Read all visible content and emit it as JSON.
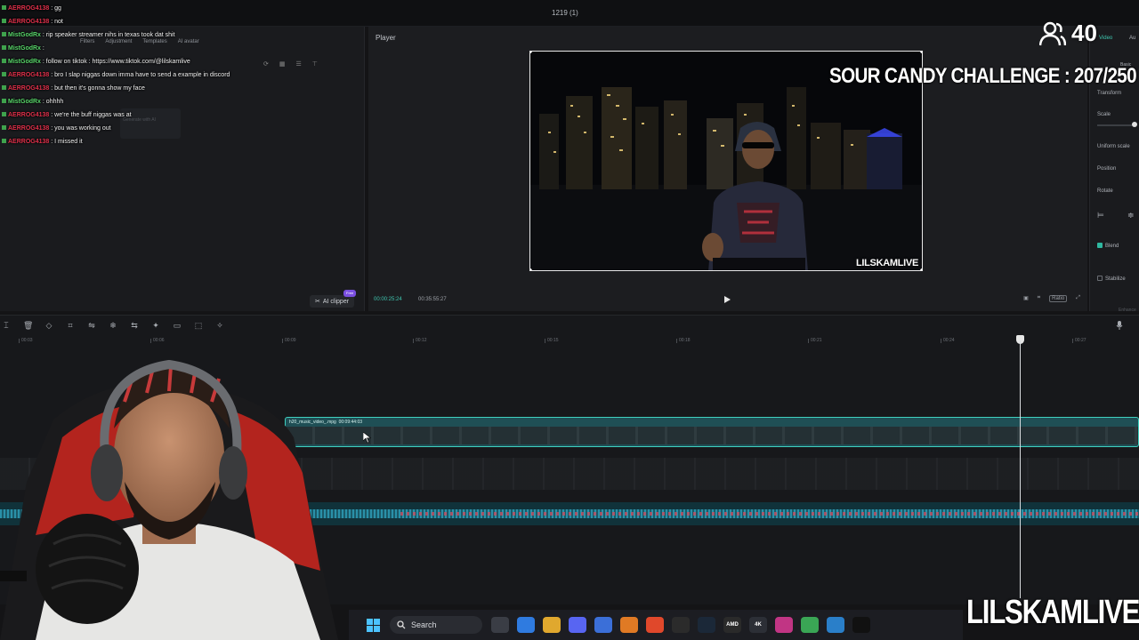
{
  "window": {
    "title": "1219 (1)"
  },
  "media_panel": {
    "tabs": [
      "Filters",
      "Adjustment",
      "Templates",
      "AI avatar"
    ],
    "ghost_label": "Generate with AI",
    "ai_clipper_label": "AI clipper",
    "ai_clipper_badge": "Free"
  },
  "chat": {
    "lines": [
      {
        "user": "AERROG4138",
        "sep": " : ",
        "msg": "gg"
      },
      {
        "user": "AERROG4138",
        "sep": " : ",
        "msg": "not"
      },
      {
        "user": "MistGodRx",
        "sep": " : ",
        "msg": "rip speaker streamer nihs in texas took dat shit"
      },
      {
        "user": "MistGodRx",
        "sep": " : ",
        "msg": ""
      },
      {
        "user": "MistGodRx",
        "sep": " : ",
        "msg": "follow on tiktok : https://www.tiktok.com/@lilskamlive"
      },
      {
        "user": "AERROG4138",
        "sep": " : ",
        "msg": "bro I slap niggas down imma have to send a example in discord"
      },
      {
        "user": "AERROG4138",
        "sep": " : ",
        "msg": "but then it's gonna show my face"
      },
      {
        "user": "MistGodRx",
        "sep": " : ",
        "msg": "ohhhh"
      },
      {
        "user": "AERROG4138",
        "sep": " : ",
        "msg": "we're the buff niggas was at"
      },
      {
        "user": "AERROG4138",
        "sep": " : ",
        "msg": "you was working out"
      },
      {
        "user": "AERROG4138",
        "sep": " : ",
        "msg": "I missed it"
      }
    ]
  },
  "player": {
    "label": "Player",
    "watermark": "LILSKAMLIVE",
    "time_current": "00:00:25:24",
    "time_total": "00:35:55:27",
    "ratio_label": "Ratio"
  },
  "inspector": {
    "tab_video": "Video",
    "tab_audio": "Au",
    "basic": "Basic",
    "transform": "Transform",
    "scale": "Scale",
    "uniform_scale": "Uniform scale",
    "position": "Position",
    "rotate": "Rotate",
    "blend": "Blend",
    "stabilize": "Stabilize",
    "enhance": "Enhance"
  },
  "overlays": {
    "viewer_count": "40",
    "challenge": "SOUR CANDY CHALLENGE : 207/250",
    "brand": "LILSKAMLIVE"
  },
  "timeline": {
    "ticks": [
      "00:03",
      "00:06",
      "00:09",
      "00:12",
      "00:15",
      "00:18",
      "00:21",
      "00:24",
      "00:27"
    ],
    "clip_name": "h20_music_video_.mpg",
    "clip_duration": "00:09:44:03"
  },
  "taskbar": {
    "search_label": "Search",
    "apps": [
      {
        "name": "widgets-app",
        "color": "#3a3d45",
        "label": ""
      },
      {
        "name": "copilot-app",
        "color": "#2f7be0",
        "label": ""
      },
      {
        "name": "files-app",
        "color": "#e0a82e",
        "label": ""
      },
      {
        "name": "discord-app",
        "color": "#5865f2",
        "label": ""
      },
      {
        "name": "store-app",
        "color": "#3b6fd8",
        "label": ""
      },
      {
        "name": "fl-app",
        "color": "#e07a24",
        "label": ""
      },
      {
        "name": "brave-app",
        "color": "#e0482b",
        "label": ""
      },
      {
        "name": "chrome-app",
        "color": "#2b2b2b",
        "label": ""
      },
      {
        "name": "steam-app",
        "color": "#1b2838",
        "label": ""
      },
      {
        "name": "amd-app",
        "color": "#2a2a2a",
        "label": "AMD"
      },
      {
        "name": "4k-app",
        "color": "#2c2f36",
        "label": "4K"
      },
      {
        "name": "instagram-app",
        "color": "#c13584",
        "label": ""
      },
      {
        "name": "layers-app",
        "color": "#3aa655",
        "label": ""
      },
      {
        "name": "notepad-app",
        "color": "#2a7fc9",
        "label": ""
      },
      {
        "name": "capcut-app",
        "color": "#111111",
        "label": ""
      }
    ]
  },
  "colors": {
    "accent": "#3fd0c0",
    "chat_red": "#e0304a",
    "chat_green": "#58d66a"
  }
}
